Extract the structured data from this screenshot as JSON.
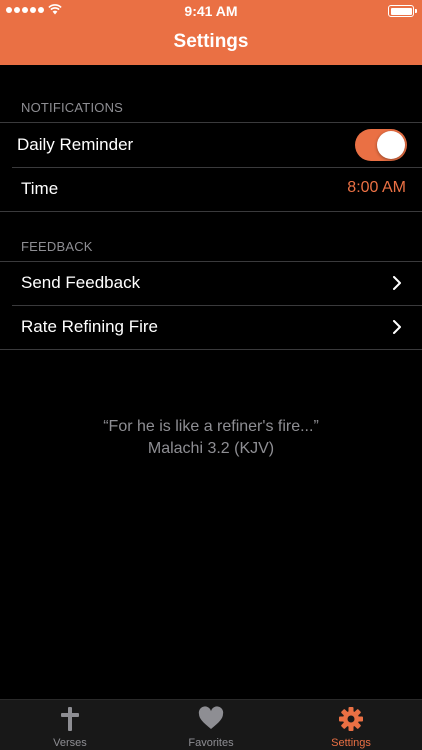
{
  "status_bar": {
    "time": "9:41 AM"
  },
  "nav": {
    "title": "Settings"
  },
  "sections": {
    "notifications": {
      "header": "NOTIFICATIONS",
      "daily_reminder_label": "Daily Reminder",
      "daily_reminder_on": true,
      "time_label": "Time",
      "time_value": "8:00 AM"
    },
    "feedback": {
      "header": "FEEDBACK",
      "send_feedback_label": "Send Feedback",
      "rate_label": "Rate Refining Fire"
    }
  },
  "quote": {
    "text": "“For he is like a refiner's fire...”",
    "reference": "Malachi 3.2 (KJV)"
  },
  "tabs": [
    {
      "label": "Verses",
      "icon": "cross-icon",
      "active": false
    },
    {
      "label": "Favorites",
      "icon": "heart-icon",
      "active": false
    },
    {
      "label": "Settings",
      "icon": "gear-icon",
      "active": true
    }
  ],
  "colors": {
    "accent": "#ea7044",
    "background": "#000000",
    "tab_bar": "#181818",
    "secondary_text": "#8e8e93"
  }
}
